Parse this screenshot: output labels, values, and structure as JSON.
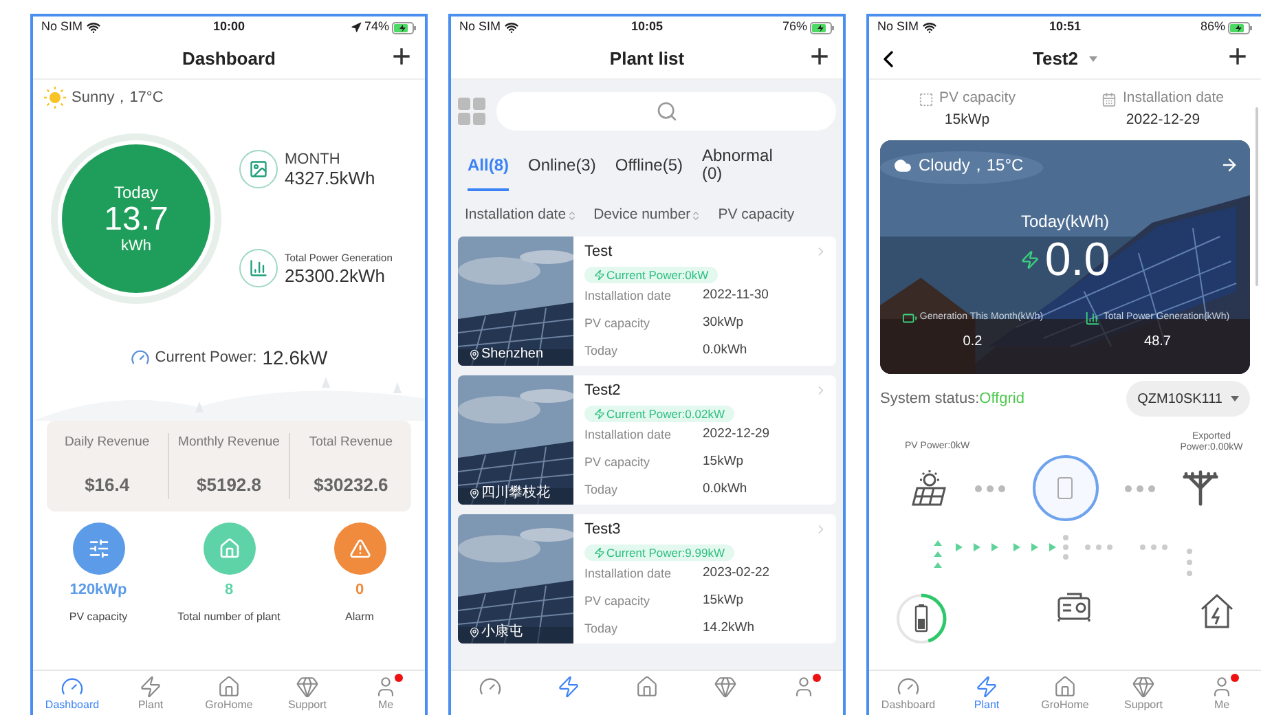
{
  "phones": [
    {
      "kind": "dashboard",
      "status_bar": {
        "carrier": "No SIM",
        "time": "10:00",
        "location": true,
        "battery": "74%"
      },
      "header": {
        "title": "Dashboard",
        "add": "+"
      },
      "weather": "Sunny，17°C",
      "today": {
        "label": "Today",
        "value": "13.7",
        "unit": "kWh"
      },
      "totals": [
        {
          "kind": "month",
          "label": "MONTH",
          "value": "4327.5kWh"
        },
        {
          "kind": "total",
          "label": "Total Power Generation",
          "value": "25300.2kWh"
        }
      ],
      "current_power": {
        "label": "Current Power:",
        "value": "12.6kW"
      },
      "revenue": [
        {
          "label": "Daily Revenue",
          "value": "$16.4"
        },
        {
          "label": "Monthly Revenue",
          "value": "$5192.8"
        },
        {
          "label": "Total Revenue",
          "value": "$30232.6"
        }
      ],
      "summary": [
        {
          "kind": "capacity",
          "value": "120kWp",
          "label": "PV capacity",
          "color": "#5b9be8"
        },
        {
          "kind": "plants",
          "value": "8",
          "label": "Total number of plant",
          "color": "#5fd3a8"
        },
        {
          "kind": "alarm",
          "value": "0",
          "label": "Alarm",
          "color": "#f08a3c"
        }
      ],
      "tabbar": [
        {
          "label": "Dashboard",
          "selected": true
        },
        {
          "label": "Plant",
          "selected": false
        },
        {
          "label": "GroHome",
          "selected": false
        },
        {
          "label": "Support",
          "selected": false
        },
        {
          "label": "Me",
          "selected": false,
          "badge": true
        }
      ]
    },
    {
      "kind": "plant_list",
      "status_bar": {
        "carrier": "No SIM",
        "time": "10:05",
        "battery": "76%"
      },
      "header": {
        "title": "Plant list",
        "add": "+"
      },
      "filters": [
        {
          "label": "All(8)",
          "selected": true
        },
        {
          "label": "Online(3)",
          "selected": false
        },
        {
          "label": "Offline(5)",
          "selected": false
        },
        {
          "label": "Abnormal(0)",
          "selected": false
        }
      ],
      "sort_columns": [
        "Installation date",
        "Device number",
        "PV capacity"
      ],
      "plants": [
        {
          "name": "Test",
          "power": "Current Power:0kW",
          "location": "Shenzhen",
          "fields": [
            {
              "label": "Installation date",
              "value": "2022-11-30"
            },
            {
              "label": "PV capacity",
              "value": "30kWp"
            },
            {
              "label": "Today",
              "value": "0.0kWh"
            }
          ]
        },
        {
          "name": "Test2",
          "power": "Current Power:0.02kW",
          "location": "四川攀枝花",
          "fields": [
            {
              "label": "Installation date",
              "value": "2022-12-29"
            },
            {
              "label": "PV capacity",
              "value": "15kWp"
            },
            {
              "label": "Today",
              "value": "0.0kWh"
            }
          ]
        },
        {
          "name": "Test3",
          "power": "Current Power:9.99kW",
          "location": "小康屯",
          "fields": [
            {
              "label": "Installation date",
              "value": "2023-02-22"
            },
            {
              "label": "PV capacity",
              "value": "15kWp"
            },
            {
              "label": "Today",
              "value": "14.2kWh"
            }
          ]
        }
      ],
      "tabbar": [
        {
          "selected": false
        },
        {
          "selected": true
        },
        {
          "selected": false
        },
        {
          "selected": false
        },
        {
          "selected": false,
          "badge": true
        }
      ]
    },
    {
      "kind": "plant_detail",
      "status_bar": {
        "carrier": "No SIM",
        "time": "10:51",
        "battery": "86%"
      },
      "header": {
        "title": "Test2",
        "back": true,
        "dropdown": true,
        "add": "+"
      },
      "info": [
        {
          "kind": "capacity",
          "label": "PV capacity",
          "value": "15kWp"
        },
        {
          "kind": "date",
          "label": "Installation date",
          "value": "2022-12-29"
        }
      ],
      "hero": {
        "weather": "Cloudy，15°C",
        "today_label": "Today(kWh)",
        "today_value": "0.0",
        "stats": [
          {
            "kind": "month",
            "label": "Generation This Month(kWh)",
            "value": "0.2"
          },
          {
            "kind": "total",
            "label": "Total Power Generation(kWh)",
            "value": "48.7"
          }
        ]
      },
      "system_status": {
        "label": "System status:",
        "value": "Offgrid"
      },
      "device": "QZM10SK111",
      "flow": {
        "pv_label": "PV Power:0kW",
        "grid_label": "Exported Power:0.00kW",
        "battery": {
          "level": 0.45
        }
      },
      "tabbar": [
        {
          "label": "Dashboard",
          "selected": false
        },
        {
          "label": "Plant",
          "selected": true
        },
        {
          "label": "GroHome",
          "selected": false
        },
        {
          "label": "Support",
          "selected": false
        },
        {
          "label": "Me",
          "selected": false,
          "badge": true
        }
      ]
    }
  ]
}
